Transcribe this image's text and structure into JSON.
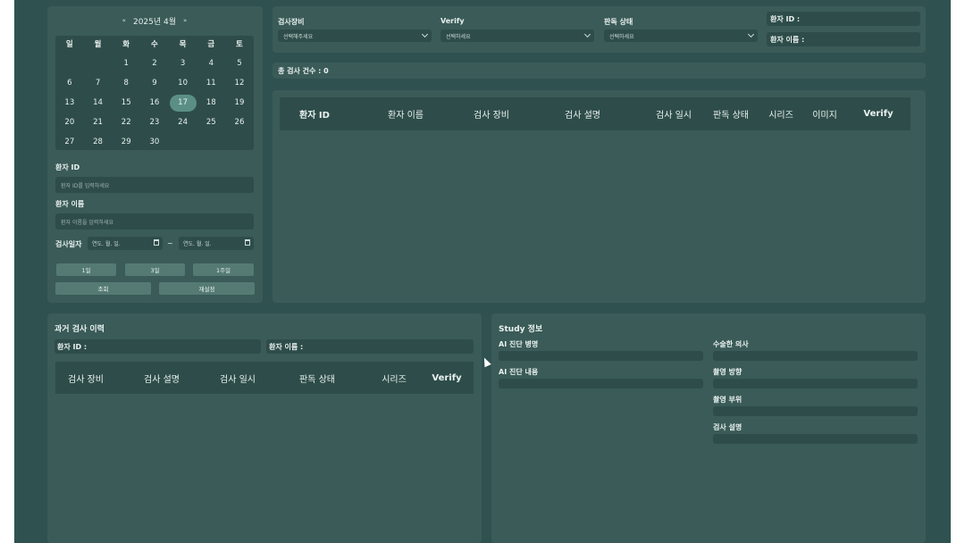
{
  "calendar": {
    "title": "2025년 4월",
    "prev": "«",
    "next": "»",
    "dows": [
      "일",
      "월",
      "화",
      "수",
      "목",
      "금",
      "토"
    ],
    "weeks": [
      [
        "",
        "",
        "1",
        "2",
        "3",
        "4",
        "5"
      ],
      [
        "6",
        "7",
        "8",
        "9",
        "10",
        "11",
        "12"
      ],
      [
        "13",
        "14",
        "15",
        "16",
        "17",
        "18",
        "19"
      ],
      [
        "20",
        "21",
        "22",
        "23",
        "24",
        "25",
        "26"
      ],
      [
        "27",
        "28",
        "29",
        "30",
        "",
        "",
        ""
      ]
    ],
    "selected": "17"
  },
  "search": {
    "patient_id_label": "환자 ID",
    "patient_id_placeholder": "환자 ID를 입력하세요",
    "patient_name_label": "환자 이름",
    "patient_name_placeholder": "환자 이름을 입력하세요",
    "date_label": "검사일자",
    "date_from": "연도. 월. 일.",
    "date_to": "연도. 월. 일.",
    "date_sep": "~",
    "btn_1day": "1일",
    "btn_3day": "3일",
    "btn_1week": "1주일",
    "btn_search": "조회",
    "btn_reset": "재설정"
  },
  "filters": {
    "device_label": "검사장비",
    "device_value": "선택해주세요",
    "verify_label": "Verify",
    "verify_value": "선택하세요",
    "status_label": "판독 상태",
    "status_value": "선택하세요",
    "patient_id_label": "환자 ID :",
    "patient_name_label": "환자 이름 :"
  },
  "total": {
    "label": "총 검사 건수 : 0"
  },
  "main_table": {
    "headers": [
      "환자 ID",
      "환자 이름",
      "검사 장비",
      "검사 설명",
      "검사 일시",
      "판독 상태",
      "시리즈",
      "이미지",
      "Verify"
    ]
  },
  "history": {
    "title": "과거 검사 이력",
    "patient_id_label": "환자 ID :",
    "patient_name_label": "환자 이름 :",
    "headers": [
      "검사 장비",
      "검사 설명",
      "검사 일시",
      "판독 상태",
      "시리즈",
      "Verify"
    ]
  },
  "study": {
    "title": "Study 정보",
    "ai_diagnosis_label": "AI 진단 병명",
    "ai_content_label": "AI 진단 내용",
    "doctor_label": "수술한 의사",
    "direction_label": "촬영 방향",
    "region_label": "촬영 부위",
    "desc_label": "검사 설명"
  }
}
